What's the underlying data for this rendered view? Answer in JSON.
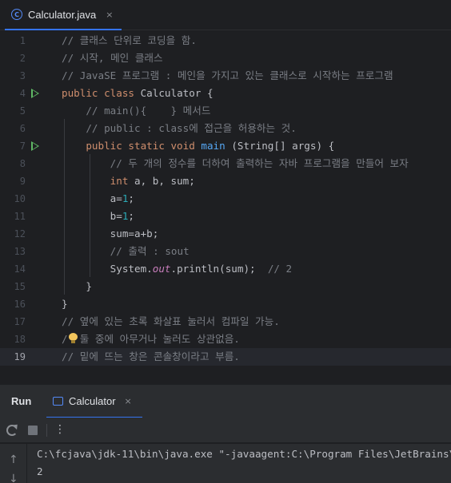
{
  "editor_tab": {
    "label": "Calculator.java",
    "icon": "java-class-icon",
    "close": "×"
  },
  "code_lines": [
    {
      "n": "1"
    },
    {
      "n": "2"
    },
    {
      "n": "3"
    },
    {
      "n": "4"
    },
    {
      "n": "5"
    },
    {
      "n": "6"
    },
    {
      "n": "7"
    },
    {
      "n": "8"
    },
    {
      "n": "9"
    },
    {
      "n": "10"
    },
    {
      "n": "11"
    },
    {
      "n": "12"
    },
    {
      "n": "13"
    },
    {
      "n": "14"
    },
    {
      "n": "15"
    },
    {
      "n": "16"
    },
    {
      "n": "17"
    },
    {
      "n": "18"
    },
    {
      "n": "19"
    }
  ],
  "code": {
    "l1": "// 클래스 단위로 코딩을 함.",
    "l2": "// 시작, 메인 클래스",
    "l3": "// JavaSE 프로그램 : 메인을 가지고 있는 클래스로 시작하는 프로그램",
    "l4_kw": "public class",
    "l4_rest": " Calculator {",
    "l5": "    // main(){    } 메서드",
    "l6": "    // public : class에 접근을 허용하는 것.",
    "l7_kw": "    public static void",
    "l7_fn": " main",
    "l7_rest": " (String[] args) {",
    "l8": "        // 두 개의 정수를 더하여 출력하는 자바 프로그램을 만들어 보자",
    "l9_kw": "        int",
    "l9_rest": " a, b, sum;",
    "l10_a": "        a=",
    "l10_num": "1",
    "l10_end": ";",
    "l11_a": "        b=",
    "l11_num": "1",
    "l11_end": ";",
    "l12": "        sum=a+b;",
    "l13": "        // 출력 : sout",
    "l14_a": "        System.",
    "l14_field": "out",
    "l14_b": ".println(sum);  ",
    "l14_cmt": "// 2",
    "l15": "    }",
    "l16": "}",
    "l17": "// 옆에 있는 초록 화살표 눌러서 컴파일 가능.",
    "l18_a": "/",
    "l18_b": "  둘 중에 아무거나 눌러도 상관없음.",
    "l19": "// 밑에 뜨는 창은 콘솔창이라고 부름."
  },
  "run_panel": {
    "title": "Run",
    "tab_label": "Calculator",
    "tab_close": "×",
    "more": "⋮",
    "console_lines": [
      "C:\\fcjava\\jdk-11\\bin\\java.exe \"-javaagent:C:\\Program Files\\JetBrains\\",
      "2"
    ]
  },
  "colors": {
    "background": "#1e1f22",
    "keyword": "#cf8e6d",
    "comment": "#7a7e85",
    "number": "#2aacb8",
    "function": "#56a8f5",
    "accent": "#3574f0",
    "run_arrow": "#5fb865"
  }
}
